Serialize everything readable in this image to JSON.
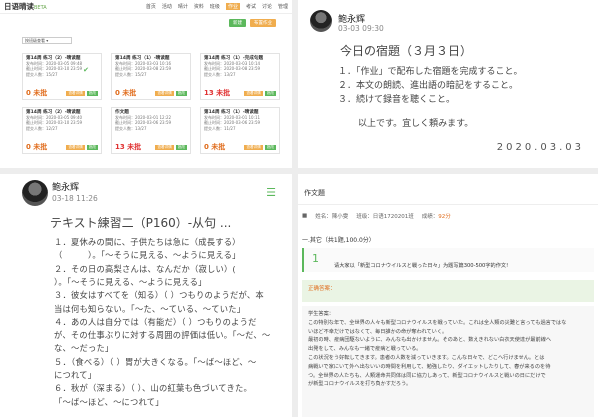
{
  "panel_a": {
    "logo": "日语晴读",
    "logo_sub": "BETA",
    "nav": [
      "首页",
      "活动",
      "晴计",
      "资料",
      "班级",
      "作业",
      "考试",
      "讨论",
      "管理"
    ],
    "nav_current": 5,
    "buttons": [
      "新建",
      "布置作业"
    ],
    "select_value": "按班级查看",
    "cards": [
      {
        "title": "第14周 练习（2）-晴读题",
        "l1": "发布时间：2020-03-05 09:48",
        "l2": "截止时间：2020-03-10 23:59",
        "l3": "提交人数：15/27",
        "score": "0",
        "score_label": "0 未批",
        "check": true
      },
      {
        "title": "第14周 练习（1）-晴读题",
        "l1": "发布时间：2020-03-03 10:16",
        "l2": "截止时间：2020-03-08 23:59",
        "l3": "提交人数：15/27",
        "score": "0",
        "score_label": "0 未批",
        "check": false
      },
      {
        "title": "第14周 练习（1）-完成句题",
        "l1": "发布时间：2020-03-03 10:14",
        "l2": "截止时间：2020-03-08 23:59",
        "l3": "提交人数：13/27",
        "score": "13",
        "score_label": "13 未批",
        "check": false
      },
      {
        "title": "第14周 练习（2）-晴读题",
        "l1": "发布时间：2020-03-05 09:40",
        "l2": "截止时间：2020-03-10 23:59",
        "l3": "提交人数：12/27",
        "score": "0",
        "score_label": "0 未批",
        "check": false
      },
      {
        "title": "作文题",
        "l1": "发布时间：2020-03-01 12:22",
        "l2": "截止时间：2020-03-06 23:59",
        "l3": "提交人数：13/27",
        "score": "13",
        "score_label": "13 未批",
        "check": false
      },
      {
        "title": "第14周 练习（1）-晴读题",
        "l1": "发布时间：2020-03-01 10:11",
        "l2": "截止时间：2020-03-06 23:59",
        "l3": "提交人数：11/27",
        "score": "0",
        "score_label": "0 未批",
        "check": false
      }
    ],
    "card_btn_1": "查看详情",
    "card_btn_2": "批改"
  },
  "panel_b": {
    "name": "鲍永辉",
    "date": "03-03 09:30",
    "title": "今日の宿題（３月３日）",
    "lines": [
      "１．「作业」で配布した宿題を完成すること。",
      "２．本文の朗読、進出語の暗記をすること。",
      "３．続けて録音を聴くこと。"
    ],
    "end": "以上です。宜しく頼みます。",
    "sign_date": "2020.03.03"
  },
  "panel_c": {
    "name": "鲍永辉",
    "date": "03-18 11:26",
    "title": "テキスト練習二（P160）-从句 ...",
    "lines": [
      "１．夏休みの間に、子供たちは急に（成長する）",
      "（　　　）。「～そうに見える、～ように見える」",
      "２．その日の高梨さんは、なんだか（寂しい）(",
      "）。「～そうに見える、～ように見える」",
      "３．彼女はすべてを（知る）（ ）つもりのようだが、本",
      "当は何も知らない。「～た、～ている、～ていた」",
      "４．あの人は自分では（有能だ）（ ）つもりのようだ",
      "が、その仕事ぶりに対する周囲の評価は低い。「～だ、～",
      "な、～だった」",
      "５．（食べる）（ ）胃が大きくなる。「～ば～ほど、～",
      "につれて」",
      "６．秋が（深まる）（ ）、山の紅葉も色づいてきた。",
      "「～ば～ほど、～につれて」"
    ]
  },
  "panel_d": {
    "header": "作文題",
    "meta_name": "姓名：陳小雯",
    "meta_class": "班级：日语1720201班",
    "meta_score": "成绩：",
    "score": "92分",
    "section": "一.其它（共1题,100.0分）",
    "q_no": "1",
    "q_text": "请大家以「新型コロナウイルスと戦った日々」为题写篇300-500字的作文!",
    "answer_label": "正确答案：",
    "student_label": "学生答案：",
    "student_lines": [
      "この特別な年で、全世界の人々も新型コロナウイルスを戦っていた。これは全人類の災難と言っても過言ではな",
      "いほど不幸だけではなくて、毎日誰かの命が奪われていく。",
      "最初の時、疫病団駆ないように、みんなも出かけません。そのあと、数えきれない白衣天使達が最前線へ",
      "出発をして、みんなも一緒で疫病と戦っている。",
      "この状況をう好転してきます。患者の人数を減っていきます。こんな日々で、どこへ行けません。とは",
      "病戦いで家にいて外へ出ないいの時間を利用して、勉強したり、ダイエットしたりして、春が来るのを待",
      "つ。全世界の人たちも、人類運命共同体は同に協力しあって、新型コロナウイルスと戦いの日にだけで",
      "が新型コロナウイルスを打ち負かすだろう。"
    ]
  }
}
